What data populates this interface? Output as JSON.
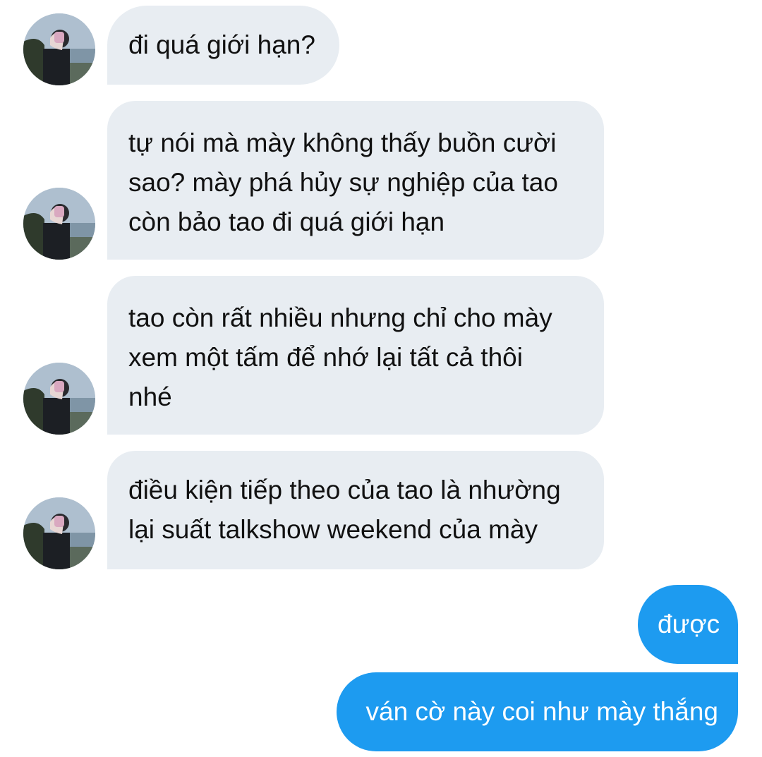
{
  "conversation": {
    "messages": [
      {
        "side": "received",
        "lines": [
          "đi quá giới hạn?"
        ]
      },
      {
        "side": "received",
        "lines": [
          "tự nói mà mày không thấy buồn cười",
          "sao? mày phá hủy sự nghiệp của tao",
          "còn bảo tao đi quá giới hạn"
        ]
      },
      {
        "side": "received",
        "lines": [
          "tao còn rất nhiều nhưng chỉ cho mày",
          "xem một tấm để nhớ lại tất cả thôi",
          "nhé"
        ]
      },
      {
        "side": "received",
        "lines": [
          "điều kiện tiếp theo của tao là nhường",
          "lại suất talkshow weekend của mày"
        ]
      },
      {
        "side": "sent",
        "lines": [
          "được"
        ]
      },
      {
        "side": "sent",
        "lines": [
          "ván cờ này coi như mày thắng"
        ]
      }
    ]
  },
  "colors": {
    "received_bubble": "#e8edf2",
    "sent_bubble": "#1d9bf0",
    "sent_text": "#ffffff",
    "received_text": "#111111"
  },
  "icons": {
    "avatar": "contact-avatar-photo"
  }
}
